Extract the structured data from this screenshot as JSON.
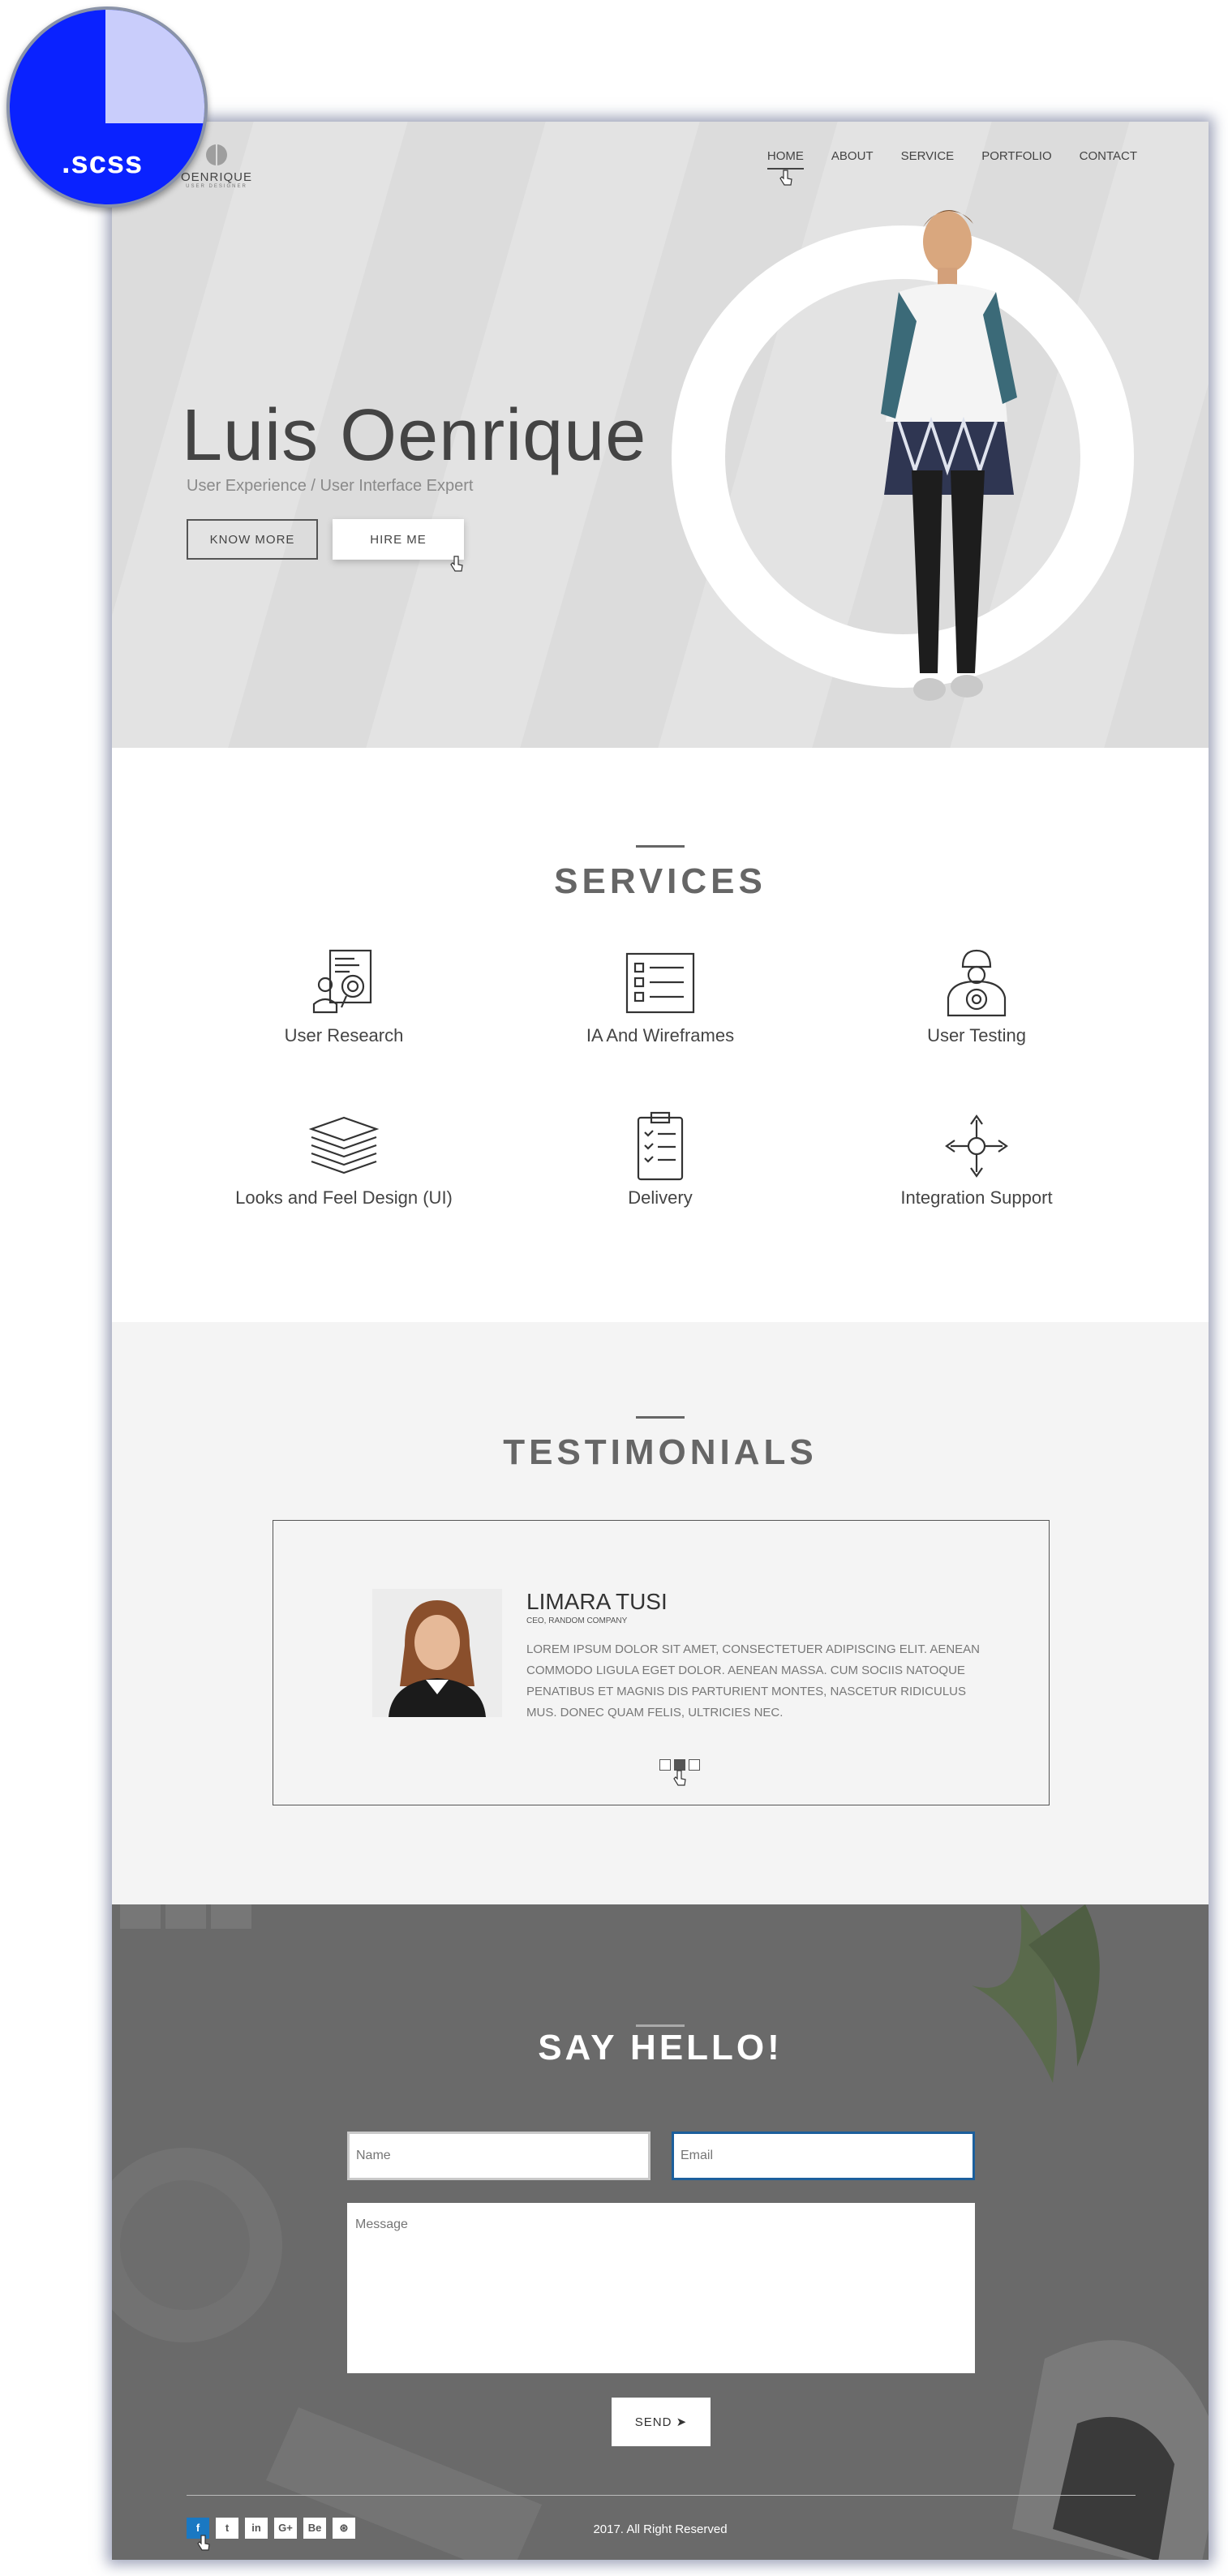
{
  "badge": {
    "text": ".scss"
  },
  "logo": {
    "name": "OENRIQUE",
    "tagline": "USER DESIGNER"
  },
  "nav": {
    "items": [
      "HOME",
      "ABOUT",
      "SERVICE",
      "PORTFOLIO",
      "CONTACT"
    ],
    "active": "HOME"
  },
  "hero": {
    "title": "Luis Oenrique",
    "subtitle": "User Experience / User Interface Expert",
    "know_more": "KNOW MORE",
    "hire_me": "HIRE ME"
  },
  "services": {
    "title": "SERVICES",
    "items": [
      {
        "label": "User Research",
        "icon": "user-research-icon"
      },
      {
        "label": "IA And Wireframes",
        "icon": "wireframe-icon"
      },
      {
        "label": "User Testing",
        "icon": "user-testing-icon"
      },
      {
        "label": "Looks and Feel Design (UI)",
        "icon": "layers-icon"
      },
      {
        "label": "Delivery",
        "icon": "clipboard-icon"
      },
      {
        "label": "Integration Support",
        "icon": "integration-icon"
      }
    ]
  },
  "testimonials": {
    "title": "TESTIMONIALS",
    "name": "LIMARA TUSI",
    "role": "CEO, RANDOM COMPANY",
    "text": "LOREM IPSUM DOLOR SIT AMET, CONSECTETUER ADIPISCING ELIT. AENEAN COMMODO LIGULA EGET DOLOR. AENEAN MASSA. CUM SOCIIS NATOQUE PENATIBUS ET MAGNIS DIS PARTURIENT MONTES, NASCETUR RIDICULUS MUS. DONEC QUAM FELIS, ULTRICIES NEC."
  },
  "contact": {
    "title": "SAY HELLO!",
    "name_placeholder": "Name",
    "email_placeholder": "Email",
    "message_placeholder": "Message",
    "send": "SEND ➤"
  },
  "footer": {
    "socials": [
      "f",
      "t",
      "in",
      "G+",
      "Be",
      "⊛"
    ],
    "copyright": "2017. All Right Reserved"
  },
  "colors": {
    "accent": "#0a22ff",
    "hero_bg": "#dcdcdc",
    "contact_bg": "#6a6a6a",
    "facebook": "#1a78c2"
  }
}
